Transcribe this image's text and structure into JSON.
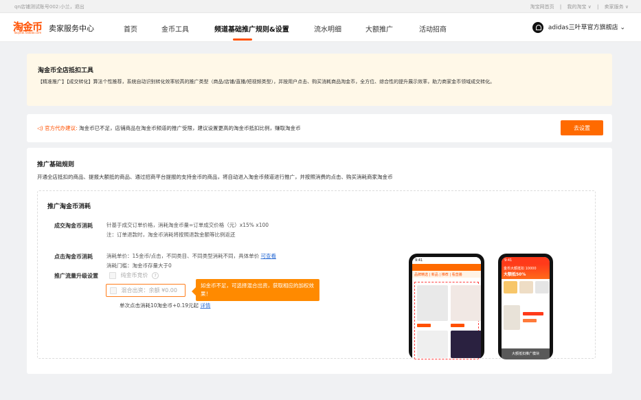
{
  "topbar": {
    "account": "qn店铺测试账号002:小兰，退出",
    "links": [
      "淘宝网首页",
      "|",
      "我的淘宝 ∨",
      "|",
      "卖家服务 ∨"
    ]
  },
  "header": {
    "brand": "淘金币",
    "brand_sub": "Taojinbi.Taobao.com",
    "title": "卖家服务中心",
    "nav": [
      "首页",
      "金币工具",
      "频道基础推广规则&设置",
      "流水明细",
      "大额推广",
      "活动招商"
    ],
    "active_nav": "频道基础推广规则&设置",
    "shop_name": "adidas三叶草官方旗舰店",
    "shop_caret": "⌄"
  },
  "notice": {
    "title": "淘金币全店抵扣工具",
    "desc": "【精准推广】【成交转化】算法个性推荐，系统自动识别转化效率较高的推广类型（商品/店铺/直播/短视频类型），并按用户点击、购买消耗商品淘金币，全方位、综合性的提升展示效率，助力商家金币领域成交转化。"
  },
  "advise": {
    "icon": "speaker-icon",
    "label": "官方代办建议:",
    "text": "淘金币已不足，店铺商品在淘金币频道的推广受限，建议设置更高的淘金币抵扣比例，赚取淘金币",
    "button": "去设置"
  },
  "rules": {
    "title": "推广基础规则",
    "desc": "开通全店抵扣的商品、提报大额抵的商品、通过招商平台提报的支持金币的商品，将自动进入淘金币频道进行推广，并按照消费的点击、购买消耗商家淘金币",
    "inner_title": "推广淘金币消耗",
    "deal": {
      "label": "成交淘金币消耗",
      "line1": "针基于成交订单价格，消耗淘金币量=订单成交价格（元）x15% x100",
      "line2": "注：订单退款时，淘金币消耗将按照退款金额等比例返还"
    },
    "click": {
      "label": "点击淘金币消耗",
      "line1": "消耗单价：15金币/点击，不同类目、不同类型消耗不同，具体单价",
      "link": "可查看",
      "line2": "消耗门槛：淘金币存量大于0"
    },
    "upgrade": {
      "label": "推广流量升级设置",
      "opt1": "纯金币竞价",
      "opt1_help": "?",
      "opt2": "混合出资：余额 ¥0.00",
      "tip": "如金币不足，可选择混合出资，获取相应的加权效果！",
      "note": "单次点击消耗10淘金币+0.19元起",
      "note_link": "详情"
    }
  },
  "phone1": {
    "tabs": "品牌精选 | 新品 | 推荐 | 看直播",
    "time": "9:41"
  },
  "phone2": {
    "head": "金币大额抵扣 10000",
    "tag": "大额抵50%",
    "footer": "大额抵扣推广模块",
    "time": "9:41"
  },
  "colors": {
    "accent": "#ff5000",
    "button": "#ff6a00",
    "tip": "#ff8a00",
    "notice_bg": "#fff8e8",
    "link": "#2f6fd6"
  }
}
